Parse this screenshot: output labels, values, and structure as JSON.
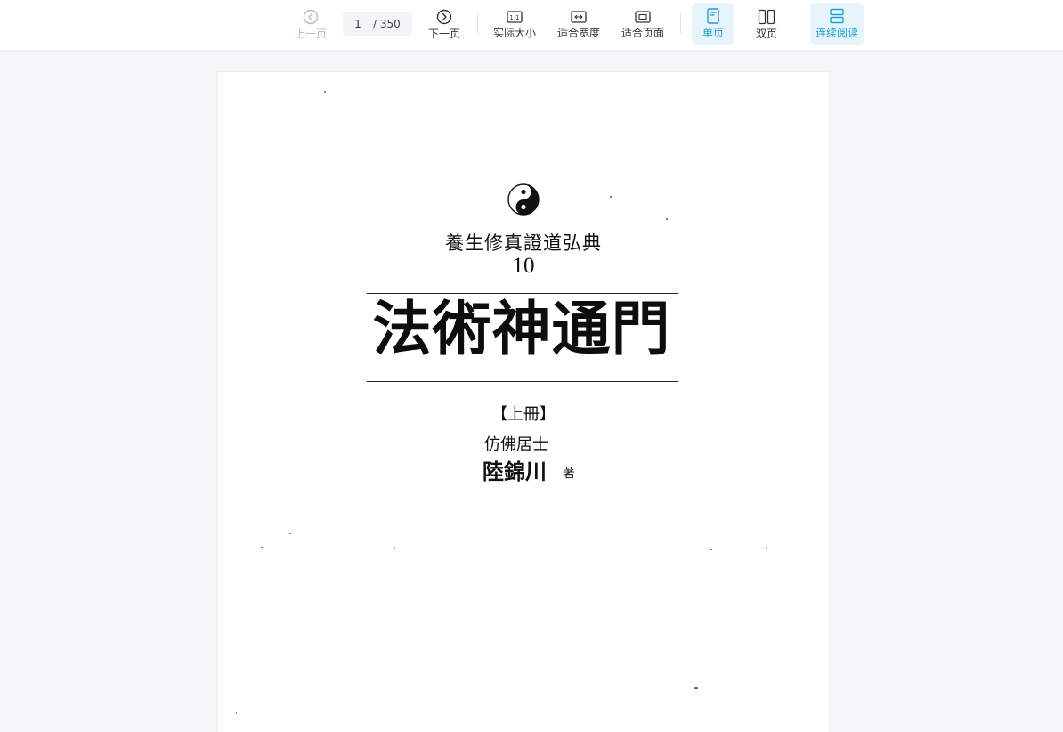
{
  "toolbar": {
    "prev_label": "上一页",
    "next_label": "下一页",
    "page_current": "1",
    "page_total": "/ 350",
    "actual_size_label": "实际大小",
    "actual_size_glyph": "1:1",
    "fit_width_label": "适合宽度",
    "fit_page_label": "适合页面",
    "single_page_label": "单页",
    "double_page_label": "双页",
    "continuous_label": "连续阅读",
    "accent_color": "#1e9fd9",
    "active_bg": "#e6f4fc",
    "disabled_color": "#b8bcc4"
  },
  "document": {
    "series_title": "養生修真證道弘典",
    "series_number": "10",
    "main_title": "法術神通門",
    "volume": "【上冊】",
    "author_prefix": "仿佛居士",
    "author_name": "陸錦川",
    "author_role": "著"
  }
}
